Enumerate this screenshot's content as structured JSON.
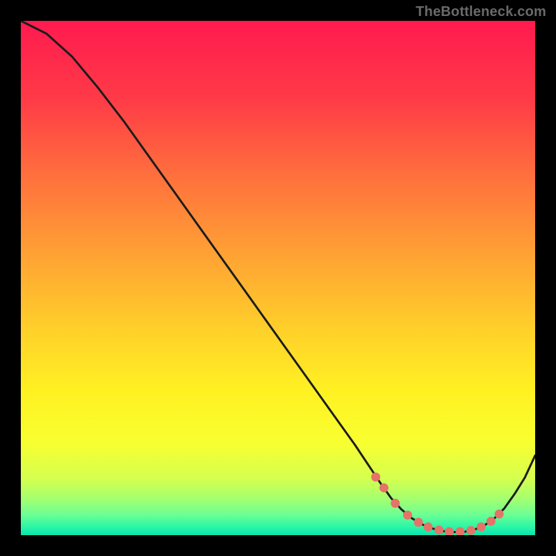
{
  "watermark": "TheBottleneck.com",
  "chart_data": {
    "type": "line",
    "title": "",
    "xlabel": "",
    "ylabel": "",
    "xlim": [
      0,
      100
    ],
    "ylim": [
      0,
      100
    ],
    "x": [
      0,
      5,
      10,
      15,
      20,
      25,
      30,
      35,
      40,
      45,
      50,
      55,
      60,
      65,
      68,
      70,
      72,
      74,
      76,
      78,
      80,
      82,
      84,
      86,
      88,
      90,
      92,
      94,
      96,
      98,
      100
    ],
    "values": [
      100,
      97.5,
      93,
      87,
      80.5,
      73.5,
      66.5,
      59.5,
      52.5,
      45.5,
      38.5,
      31.5,
      24.5,
      17.5,
      13,
      10,
      7.2,
      5,
      3.3,
      2.1,
      1.3,
      0.8,
      0.6,
      0.6,
      1,
      1.8,
      3.2,
      5.2,
      8,
      11.2,
      15.5
    ],
    "highlight_points": [
      {
        "x": 69,
        "y": 11.3
      },
      {
        "x": 70.6,
        "y": 9.2
      },
      {
        "x": 72.8,
        "y": 6.2
      },
      {
        "x": 75.2,
        "y": 3.9
      },
      {
        "x": 77.3,
        "y": 2.5
      },
      {
        "x": 79.2,
        "y": 1.6
      },
      {
        "x": 81.3,
        "y": 1
      },
      {
        "x": 83.3,
        "y": 0.7
      },
      {
        "x": 85.4,
        "y": 0.7
      },
      {
        "x": 87.5,
        "y": 0.9
      },
      {
        "x": 89.5,
        "y": 1.6
      },
      {
        "x": 91.4,
        "y": 2.7
      },
      {
        "x": 93,
        "y": 4.1
      }
    ],
    "gradient_stops": [
      {
        "offset": 0.0,
        "color": "#ff1a4f"
      },
      {
        "offset": 0.15,
        "color": "#ff3a47"
      },
      {
        "offset": 0.3,
        "color": "#ff6f3d"
      },
      {
        "offset": 0.45,
        "color": "#ffa034"
      },
      {
        "offset": 0.6,
        "color": "#ffd02a"
      },
      {
        "offset": 0.72,
        "color": "#fff122"
      },
      {
        "offset": 0.82,
        "color": "#f8ff30"
      },
      {
        "offset": 0.89,
        "color": "#d5ff4f"
      },
      {
        "offset": 0.93,
        "color": "#a4ff70"
      },
      {
        "offset": 0.96,
        "color": "#6cff94"
      },
      {
        "offset": 0.985,
        "color": "#28f5a8"
      },
      {
        "offset": 1.0,
        "color": "#0be3b0"
      }
    ],
    "marker_color": "#e57368",
    "line_color": "#1c1c1c"
  }
}
